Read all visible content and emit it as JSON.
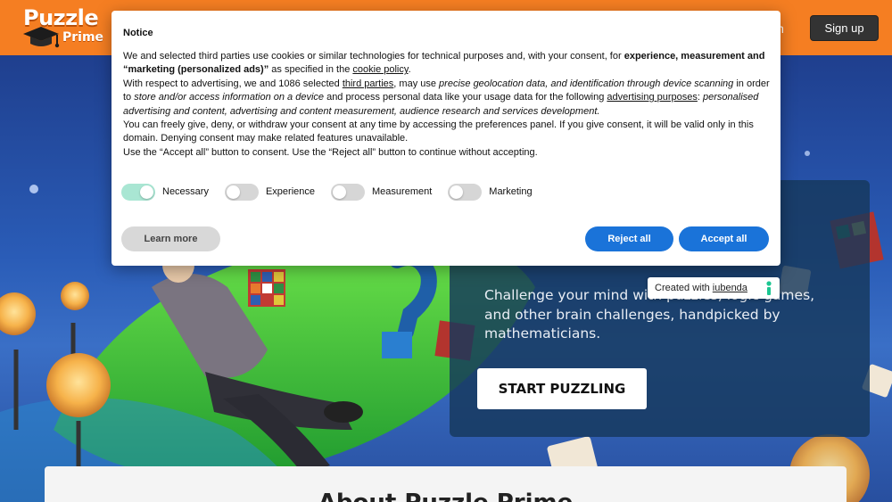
{
  "header": {
    "logo_line1": "Puzzle",
    "logo_line2": "Prime",
    "login_label": "in",
    "signup_label": "Sign up"
  },
  "hero": {
    "subtitle": "Challenge your mind with puzzles, logic games, and other brain challenges, handpicked by mathematicians.",
    "cta_label": "START PUZZLING",
    "about_title": "About Puzzle Prime"
  },
  "notice": {
    "title": "Notice",
    "p1_a": "We and selected third parties use cookies or similar technologies for technical purposes and, with your consent, for ",
    "p1_b": "experience, measurement and “marketing (personalized ads)”",
    "p1_c": " as specified in the ",
    "p1_link": "cookie policy",
    "p1_d": ".",
    "p2_a": "With respect to advertising, we and 1086 selected ",
    "p2_link1": "third parties",
    "p2_b": ", may use ",
    "p2_c": "precise geolocation data, and identification through device scanning",
    "p2_d": " in order to ",
    "p2_e": "store and/or access information on a device",
    "p2_f": " and process personal data like your usage data for the following ",
    "p2_link2": "advertising purposes",
    "p2_g": ": ",
    "p2_h": "personalised advertising and content, advertising and content measurement, audience research and services development.",
    "p3": "You can freely give, deny, or withdraw your consent at any time by accessing the preferences panel. If you give consent, it will be valid only in this domain. Denying consent may make related features unavailable.",
    "p4": "Use the “Accept all” button to consent. Use the “Reject all” button to continue without accepting.",
    "toggles": [
      {
        "label": "Necessary",
        "on": true
      },
      {
        "label": "Experience",
        "on": false
      },
      {
        "label": "Measurement",
        "on": false
      },
      {
        "label": "Marketing",
        "on": false
      }
    ],
    "learn_more_label": "Learn more",
    "reject_label": "Reject all",
    "accept_label": "Accept all"
  },
  "badge": {
    "prefix": "Created with",
    "link": "iubenda"
  },
  "colors": {
    "brand_orange": "#f57e22",
    "primary_blue": "#1a73d9",
    "toggle_on": "#a9e6d3",
    "dark_button": "#333333"
  },
  "icons": [
    "graduation-cap-icon",
    "iubenda-logo-icon"
  ]
}
